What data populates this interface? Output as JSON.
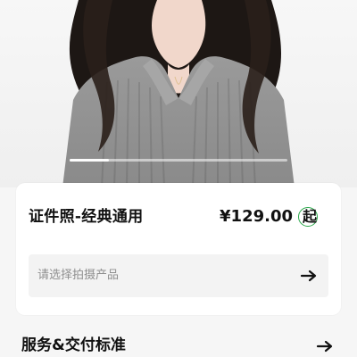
{
  "hero": {
    "progress": 0.18
  },
  "product": {
    "title": "证件照-经典通用",
    "price": "¥129.00",
    "price_suffix": "起",
    "select_placeholder": "请选择拍摄产品",
    "select_icon": "arrow-right-icon"
  },
  "section": {
    "title": "服务&交付标准",
    "icon": "arrow-right-icon"
  },
  "colors": {
    "background": "#f6f6f6",
    "card_background": "#ffffff",
    "select_background": "#f3f3f3",
    "accent_green": "#2aa84a",
    "text_primary": "#111111",
    "text_placeholder": "#8f8f8f"
  }
}
